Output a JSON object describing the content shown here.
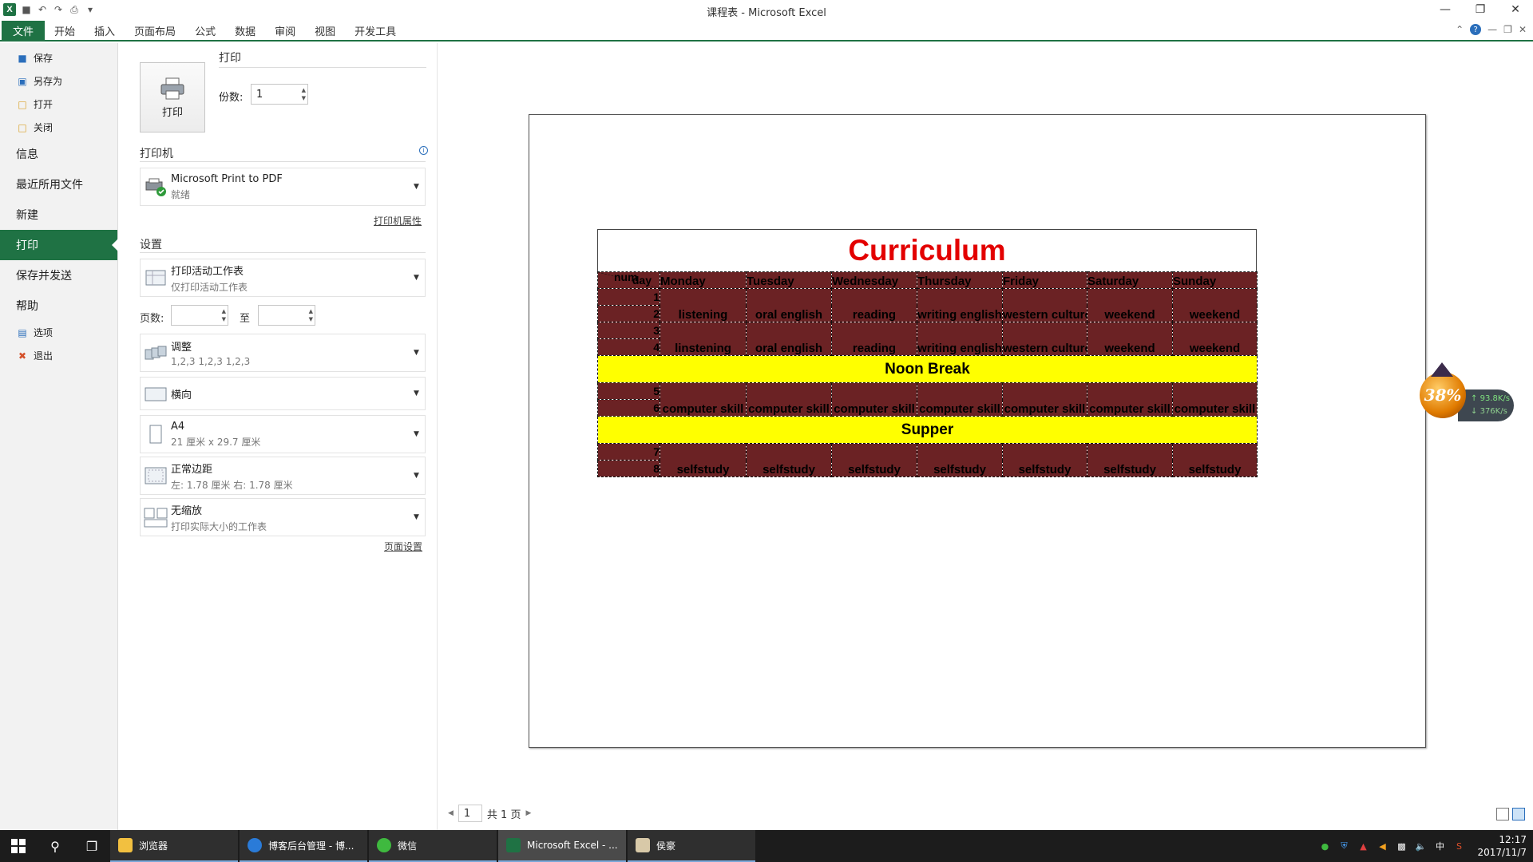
{
  "window": {
    "title": "课程表 - Microsoft Excel",
    "app_logo": "X"
  },
  "ribbon": {
    "tabs": [
      "文件",
      "开始",
      "插入",
      "页面布局",
      "公式",
      "数据",
      "审阅",
      "视图",
      "开发工具"
    ]
  },
  "backstage": {
    "save": "保存",
    "save_as": "另存为",
    "open": "打开",
    "close": "关闭",
    "info": "信息",
    "recent": "最近所用文件",
    "new": "新建",
    "print": "打印",
    "save_send": "保存并发送",
    "help": "帮助",
    "options": "选项",
    "exit": "退出"
  },
  "print_pane": {
    "print_heading": "打印",
    "print_button": "打印",
    "copies_label": "份数:",
    "copies_value": "1",
    "printer_heading": "打印机",
    "printer_name": "Microsoft Print to PDF",
    "printer_status": "就绪",
    "printer_props": "打印机属性",
    "settings_heading": "设置",
    "what_main": "打印活动工作表",
    "what_sub": "仅打印活动工作表",
    "pages_label": "页数:",
    "pages_to": "至",
    "collate_main": "调整",
    "collate_sub": "1,2,3    1,2,3    1,2,3",
    "orientation": "横向",
    "paper_main": "A4",
    "paper_sub": "21 厘米 x 29.7 厘米",
    "margins_main": "正常边距",
    "margins_sub": "左: 1.78 厘米    右: 1.78 厘米",
    "scaling_main": "无缩放",
    "scaling_sub": "打印实际大小的工作表",
    "page_setup": "页面设置"
  },
  "preview": {
    "sheet_title": "Curriculum",
    "title_color": "#e30000",
    "cell_color": "#6b2224",
    "break_color": "#ffff00",
    "corner_day": "day",
    "corner_num": "num",
    "days": [
      "Monday",
      "Tuesday",
      "Wednesday",
      "Thursday",
      "Friday",
      "Saturday",
      "Sunday"
    ],
    "rows": [
      {
        "num": "1",
        "subjects": []
      },
      {
        "num": "2",
        "subjects": [
          "listening",
          "oral english",
          "reading",
          "writing english",
          "western culture",
          "weekend",
          "weekend"
        ]
      },
      {
        "num": "3",
        "subjects": []
      },
      {
        "num": "4",
        "subjects": [
          "linstening",
          "oral english",
          "reading",
          "writing english",
          "western culture",
          "weekend",
          "weekend"
        ]
      }
    ],
    "noon_break": "Noon Break",
    "afternoon": [
      {
        "num": "5",
        "subjects": []
      },
      {
        "num": "6",
        "subjects": [
          "computer skill",
          "computer skill",
          "computer skill",
          "computer skill",
          "computer skill",
          "computer skill",
          "computer skill"
        ]
      }
    ],
    "supper": "Supper",
    "evening": [
      {
        "num": "7",
        "subjects": []
      },
      {
        "num": "8",
        "subjects": [
          "selfstudy",
          "selfstudy",
          "selfstudy",
          "selfstudy",
          "selfstudy",
          "selfstudy",
          "selfstudy"
        ]
      }
    ],
    "pager_current": "1",
    "pager_total": "共 1 页"
  },
  "net_widget": {
    "percent": "38%",
    "up": "93.8K/s",
    "down": "376K/s"
  },
  "taskbar": {
    "apps": [
      "浏览器",
      "博客后台管理 - 博...",
      "微信",
      "Microsoft Excel - ...",
      "侯豪"
    ],
    "time": "12:17",
    "date": "2017/11/7",
    "ime": "中"
  }
}
